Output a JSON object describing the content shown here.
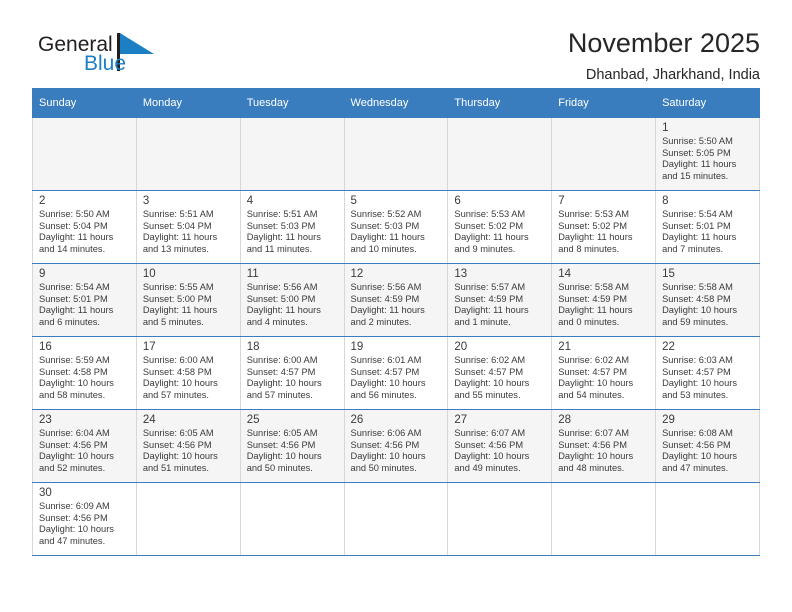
{
  "logo": {
    "word_general": "General",
    "word_blue": "Blue",
    "flag_color": "#1d7fc3",
    "text_color": "#231f20"
  },
  "header": {
    "title": "November 2025",
    "subtitle": "Dhanbad, Jharkhand, India"
  },
  "theme": {
    "header_bg": "#3a7dbf",
    "header_text": "#ffffff",
    "shaded_row_bg": "#f5f5f5",
    "cell_border": "#d7d7d7",
    "row_divider": "#3a7dbf"
  },
  "weekdays": [
    "Sunday",
    "Monday",
    "Tuesday",
    "Wednesday",
    "Thursday",
    "Friday",
    "Saturday"
  ],
  "weeks": [
    [
      {
        "day": "",
        "text": ""
      },
      {
        "day": "",
        "text": ""
      },
      {
        "day": "",
        "text": ""
      },
      {
        "day": "",
        "text": ""
      },
      {
        "day": "",
        "text": ""
      },
      {
        "day": "",
        "text": ""
      },
      {
        "day": "1",
        "text": "Sunrise: 5:50 AM\nSunset: 5:05 PM\nDaylight: 11 hours\nand 15 minutes."
      }
    ],
    [
      {
        "day": "2",
        "text": "Sunrise: 5:50 AM\nSunset: 5:04 PM\nDaylight: 11 hours\nand 14 minutes."
      },
      {
        "day": "3",
        "text": "Sunrise: 5:51 AM\nSunset: 5:04 PM\nDaylight: 11 hours\nand 13 minutes."
      },
      {
        "day": "4",
        "text": "Sunrise: 5:51 AM\nSunset: 5:03 PM\nDaylight: 11 hours\nand 11 minutes."
      },
      {
        "day": "5",
        "text": "Sunrise: 5:52 AM\nSunset: 5:03 PM\nDaylight: 11 hours\nand 10 minutes."
      },
      {
        "day": "6",
        "text": "Sunrise: 5:53 AM\nSunset: 5:02 PM\nDaylight: 11 hours\nand 9 minutes."
      },
      {
        "day": "7",
        "text": "Sunrise: 5:53 AM\nSunset: 5:02 PM\nDaylight: 11 hours\nand 8 minutes."
      },
      {
        "day": "8",
        "text": "Sunrise: 5:54 AM\nSunset: 5:01 PM\nDaylight: 11 hours\nand 7 minutes."
      }
    ],
    [
      {
        "day": "9",
        "text": "Sunrise: 5:54 AM\nSunset: 5:01 PM\nDaylight: 11 hours\nand 6 minutes."
      },
      {
        "day": "10",
        "text": "Sunrise: 5:55 AM\nSunset: 5:00 PM\nDaylight: 11 hours\nand 5 minutes."
      },
      {
        "day": "11",
        "text": "Sunrise: 5:56 AM\nSunset: 5:00 PM\nDaylight: 11 hours\nand 4 minutes."
      },
      {
        "day": "12",
        "text": "Sunrise: 5:56 AM\nSunset: 4:59 PM\nDaylight: 11 hours\nand 2 minutes."
      },
      {
        "day": "13",
        "text": "Sunrise: 5:57 AM\nSunset: 4:59 PM\nDaylight: 11 hours\nand 1 minute."
      },
      {
        "day": "14",
        "text": "Sunrise: 5:58 AM\nSunset: 4:59 PM\nDaylight: 11 hours\nand 0 minutes."
      },
      {
        "day": "15",
        "text": "Sunrise: 5:58 AM\nSunset: 4:58 PM\nDaylight: 10 hours\nand 59 minutes."
      }
    ],
    [
      {
        "day": "16",
        "text": "Sunrise: 5:59 AM\nSunset: 4:58 PM\nDaylight: 10 hours\nand 58 minutes."
      },
      {
        "day": "17",
        "text": "Sunrise: 6:00 AM\nSunset: 4:58 PM\nDaylight: 10 hours\nand 57 minutes."
      },
      {
        "day": "18",
        "text": "Sunrise: 6:00 AM\nSunset: 4:57 PM\nDaylight: 10 hours\nand 57 minutes."
      },
      {
        "day": "19",
        "text": "Sunrise: 6:01 AM\nSunset: 4:57 PM\nDaylight: 10 hours\nand 56 minutes."
      },
      {
        "day": "20",
        "text": "Sunrise: 6:02 AM\nSunset: 4:57 PM\nDaylight: 10 hours\nand 55 minutes."
      },
      {
        "day": "21",
        "text": "Sunrise: 6:02 AM\nSunset: 4:57 PM\nDaylight: 10 hours\nand 54 minutes."
      },
      {
        "day": "22",
        "text": "Sunrise: 6:03 AM\nSunset: 4:57 PM\nDaylight: 10 hours\nand 53 minutes."
      }
    ],
    [
      {
        "day": "23",
        "text": "Sunrise: 6:04 AM\nSunset: 4:56 PM\nDaylight: 10 hours\nand 52 minutes."
      },
      {
        "day": "24",
        "text": "Sunrise: 6:05 AM\nSunset: 4:56 PM\nDaylight: 10 hours\nand 51 minutes."
      },
      {
        "day": "25",
        "text": "Sunrise: 6:05 AM\nSunset: 4:56 PM\nDaylight: 10 hours\nand 50 minutes."
      },
      {
        "day": "26",
        "text": "Sunrise: 6:06 AM\nSunset: 4:56 PM\nDaylight: 10 hours\nand 50 minutes."
      },
      {
        "day": "27",
        "text": "Sunrise: 6:07 AM\nSunset: 4:56 PM\nDaylight: 10 hours\nand 49 minutes."
      },
      {
        "day": "28",
        "text": "Sunrise: 6:07 AM\nSunset: 4:56 PM\nDaylight: 10 hours\nand 48 minutes."
      },
      {
        "day": "29",
        "text": "Sunrise: 6:08 AM\nSunset: 4:56 PM\nDaylight: 10 hours\nand 47 minutes."
      }
    ],
    [
      {
        "day": "30",
        "text": "Sunrise: 6:09 AM\nSunset: 4:56 PM\nDaylight: 10 hours\nand 47 minutes."
      },
      {
        "day": "",
        "text": ""
      },
      {
        "day": "",
        "text": ""
      },
      {
        "day": "",
        "text": ""
      },
      {
        "day": "",
        "text": ""
      },
      {
        "day": "",
        "text": ""
      },
      {
        "day": "",
        "text": ""
      }
    ]
  ]
}
